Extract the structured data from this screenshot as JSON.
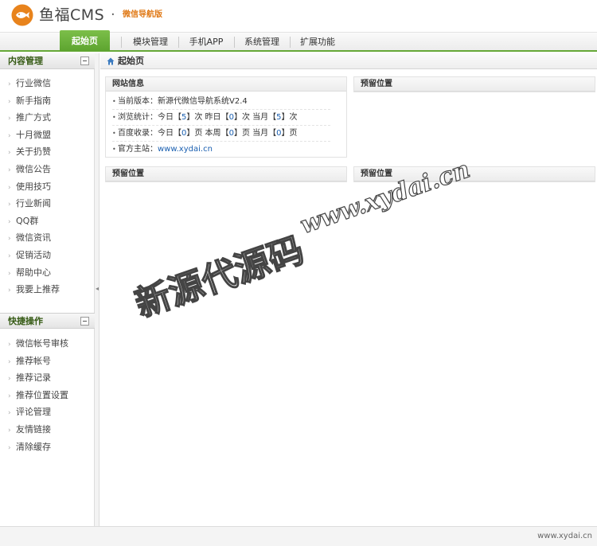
{
  "header": {
    "brand": "鱼福CMS",
    "dot": "·",
    "subtitle": "微信导航版",
    "accent": "#e07a18"
  },
  "topnav": {
    "tabs": [
      {
        "label": "起始页",
        "active": true
      },
      {
        "label": "模块管理",
        "active": false
      },
      {
        "label": "手机APP",
        "active": false
      },
      {
        "label": "系统管理",
        "active": false
      },
      {
        "label": "扩展功能",
        "active": false
      }
    ],
    "accent": "#65a837"
  },
  "sidebar": {
    "content_panel": {
      "title": "内容管理",
      "items": [
        "行业微信",
        "新手指南",
        "推广方式",
        "十月微盟",
        "关于扔赞",
        "微信公告",
        "使用技巧",
        "行业新闻",
        "QQ群",
        "微信资讯",
        "促销活动",
        "帮助中心",
        "我要上推荐"
      ]
    },
    "quick_panel": {
      "title": "快捷操作",
      "items": [
        "微信帐号审核",
        "推荐帐号",
        "推荐记录",
        "推荐位置设置",
        "评论管理",
        "友情链接",
        "清除缓存"
      ]
    }
  },
  "breadcrumb": {
    "current": "起始页"
  },
  "main": {
    "site_info": {
      "title": "网站信息",
      "version_label": "当前版本：",
      "version_value": "新源代微信导航系统V2.4",
      "visits_label": "浏览统计：",
      "visits_today_pre": "今日",
      "visits_today": "5",
      "visits_yesterday_pre": "次 昨日",
      "visits_yesterday": "0",
      "visits_month_pre": "次 当月",
      "visits_month": "5",
      "visits_suffix": "次",
      "baidu_label": "百度收录：",
      "baidu_today_pre": "今日",
      "baidu_today": "0",
      "baidu_week_pre": "页 本周",
      "baidu_week": "0",
      "baidu_month_pre": "页 当月",
      "baidu_month": "0",
      "baidu_suffix": "页",
      "site_label": "官方主站：",
      "site_link": "www.xydai.cn"
    },
    "reserved": [
      "预留位置",
      "预留位置",
      "预留位置"
    ]
  },
  "watermark": {
    "url": "www.xydai.cn",
    "cn": "新源代源码"
  },
  "footer": {
    "text": "www.xydai.cn"
  }
}
